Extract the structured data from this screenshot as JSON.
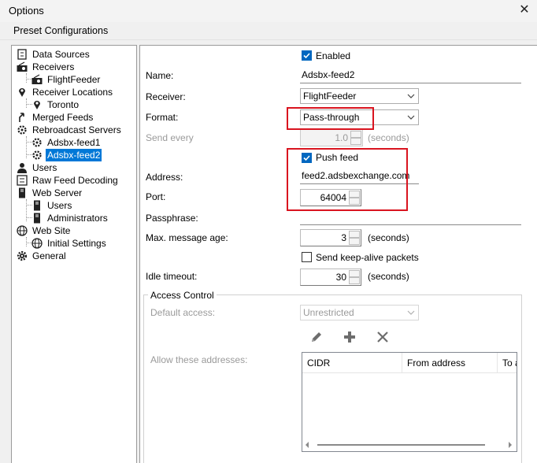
{
  "window": {
    "title": "Options",
    "close_glyph": "✕"
  },
  "menu": {
    "label": "Preset Configurations"
  },
  "tree": [
    {
      "label": "Data Sources",
      "icon": "data-sources-icon",
      "level": 0
    },
    {
      "label": "Receivers",
      "icon": "radio-icon",
      "level": 0
    },
    {
      "label": "FlightFeeder",
      "icon": "radio-icon",
      "level": 1
    },
    {
      "label": "Receiver Locations",
      "icon": "location-pin-icon",
      "level": 0
    },
    {
      "label": "Toronto",
      "icon": "location-pin-icon",
      "level": 1
    },
    {
      "label": "Merged Feeds",
      "icon": "merge-icon",
      "level": 0
    },
    {
      "label": "Rebroadcast Servers",
      "icon": "broadcast-icon",
      "level": 0
    },
    {
      "label": "Adsbx-feed1",
      "icon": "broadcast-icon",
      "level": 1
    },
    {
      "label": "Adsbx-feed2",
      "icon": "broadcast-icon",
      "level": 1,
      "selected": true
    },
    {
      "label": "Users",
      "icon": "user-icon",
      "level": 0
    },
    {
      "label": "Raw Feed Decoding",
      "icon": "decoding-icon",
      "level": 0
    },
    {
      "label": "Web Server",
      "icon": "server-icon",
      "level": 0
    },
    {
      "label": "Users",
      "icon": "server-icon",
      "level": 1
    },
    {
      "label": "Administrators",
      "icon": "server-icon",
      "level": 1
    },
    {
      "label": "Web Site",
      "icon": "globe-icon",
      "level": 0
    },
    {
      "label": "Initial Settings",
      "icon": "globe-icon",
      "level": 1
    },
    {
      "label": "General",
      "icon": "gear-icon",
      "level": 0
    }
  ],
  "form": {
    "enabled": {
      "label": "Enabled",
      "checked": true
    },
    "name": {
      "label": "Name:",
      "value": "Adsbx-feed2"
    },
    "receiver": {
      "label": "Receiver:",
      "value": "FlightFeeder"
    },
    "format": {
      "label": "Format:",
      "value": "Pass-through"
    },
    "send_every": {
      "label": "Send every",
      "value": "1.0",
      "unit": "(seconds)"
    },
    "push_feed": {
      "label": "Push feed",
      "checked": true
    },
    "address": {
      "label": "Address:",
      "value": "feed2.adsbexchange.com"
    },
    "port": {
      "label": "Port:",
      "value": "64004"
    },
    "passphrase": {
      "label": "Passphrase:",
      "value": ""
    },
    "max_message_age": {
      "label": "Max. message age:",
      "value": "3",
      "unit": "(seconds)"
    },
    "keep_alive": {
      "label": "Send keep-alive packets",
      "checked": false
    },
    "idle_timeout": {
      "label": "Idle timeout:",
      "value": "30",
      "unit": "(seconds)"
    }
  },
  "access_control": {
    "title": "Access Control",
    "default_access_label": "Default access:",
    "default_access_value": "Unrestricted",
    "allow_label": "Allow these addresses:",
    "toolbar": [
      "edit-icon",
      "add-icon",
      "delete-icon"
    ],
    "columns": [
      "CIDR",
      "From address",
      "To a"
    ]
  },
  "colors": {
    "accent": "#0078d7",
    "highlight_box": "#d9141f",
    "checkbox": "#0067c0"
  }
}
